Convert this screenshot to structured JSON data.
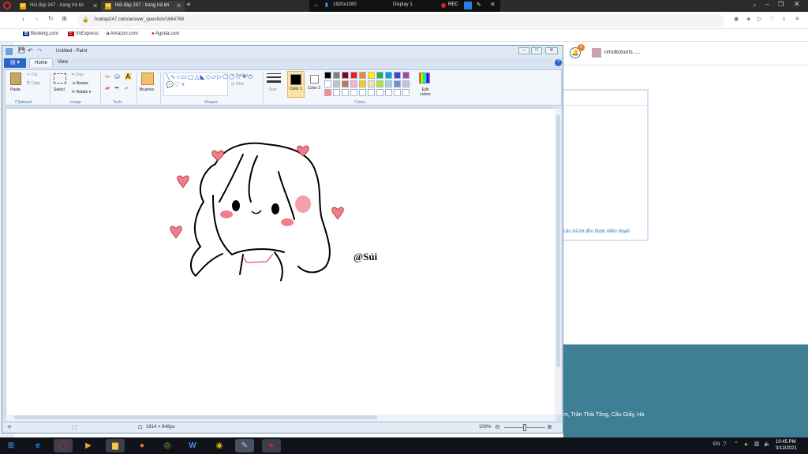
{
  "browser": {
    "tabs": [
      {
        "label": "Hỏi đáp 247 - trang trả lời"
      },
      {
        "label": "Hỏi đáp 247 - trang trả lời"
      }
    ],
    "recording": {
      "resolution": "1920x1080",
      "display": "Display 1",
      "rec": "REC"
    },
    "url": "hoidap247.com/answer_question/1684768",
    "bookmarks": [
      "Booking.com",
      "VnExpress",
      "Amazon.com",
      "Agoda.com"
    ]
  },
  "website": {
    "user": "nmokosuris ....",
    "notification_count": "1",
    "note": "câu trả lời đều được kiểm duyệt",
    "footer_address": "m, Trần Thái Tông, Cầu Giấy, Hà"
  },
  "paint": {
    "title": "Untitled - Paint",
    "tabs": [
      "Home",
      "View"
    ],
    "clipboard": {
      "paste": "Paste",
      "cut": "Cut",
      "copy": "Copy",
      "group": "Clipboard"
    },
    "image": {
      "select": "Select",
      "crop": "Crop",
      "resize": "Resize",
      "rotate": "Rotate",
      "group": "Image"
    },
    "tools": {
      "group": "Tools"
    },
    "brushes": "Brushes",
    "shapes": {
      "outline": "Outline",
      "fill": "Fill",
      "group": "Shapes"
    },
    "size": "Size",
    "color1": "Color 1",
    "color2": "Color 2",
    "edit_colors": "Edit colors",
    "colors_group": "Colors",
    "palette": [
      "#000000",
      "#7f7f7f",
      "#880015",
      "#ed1c24",
      "#ff7f27",
      "#fff200",
      "#22b14c",
      "#00a2e8",
      "#3f48cc",
      "#a349a4",
      "#ffffff",
      "#c3c3c3",
      "#b97a57",
      "#ffaec9",
      "#ffc90e",
      "#efe4b0",
      "#b5e61d",
      "#99d9ea",
      "#7092be",
      "#c8bfe7",
      "#ff8a8a",
      "#ffffff",
      "#ffffff",
      "#ffffff",
      "#ffffff",
      "#ffffff",
      "#ffffff",
      "#ffffff",
      "#ffffff",
      "#ffffff"
    ],
    "signature": "@Sủi",
    "status": {
      "dimensions": "1914 × 848px",
      "zoom": "100%"
    }
  },
  "taskbar": {
    "time": "10:45 PM",
    "date": "3/12/2021",
    "lang": "EN"
  }
}
